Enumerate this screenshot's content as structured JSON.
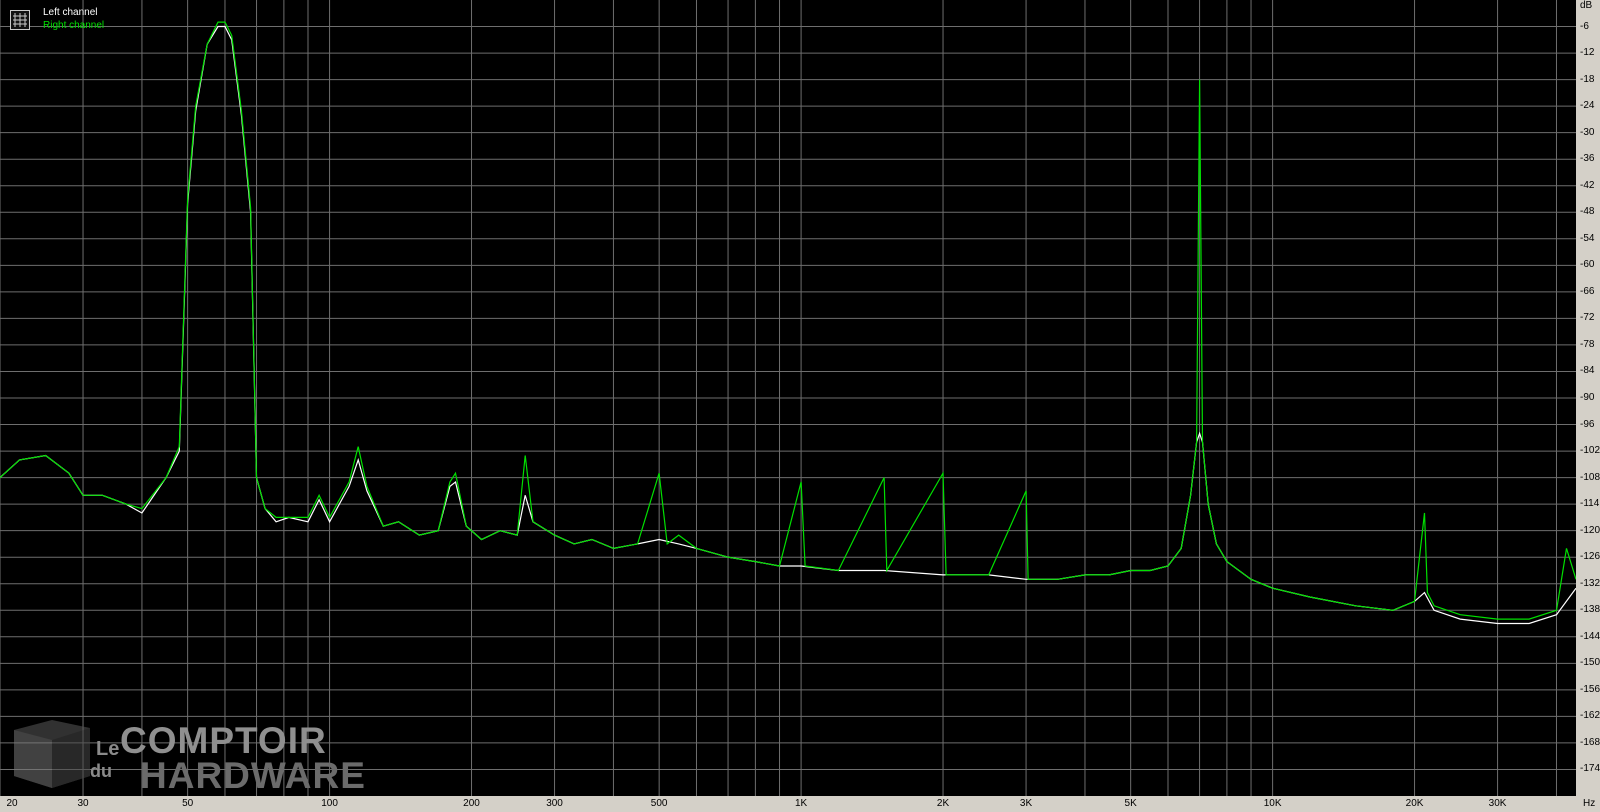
{
  "legend": {
    "left_label": "Left channel",
    "right_label": "Right channel",
    "left_color": "#ffffff",
    "right_color": "#00e000"
  },
  "watermark": {
    "le": "Le",
    "du": "du",
    "comptoir": "COMPTOIR",
    "hardware": "HARDWARE"
  },
  "chart_data": {
    "type": "line",
    "xscale": "log",
    "xlim": [
      20,
      44000
    ],
    "ylim": [
      -180,
      0
    ],
    "xunit": "Hz",
    "yunit": "dB",
    "grid": true,
    "legend_position": "top-left",
    "x_tick_labels": [
      "20",
      "30",
      "50",
      "100",
      "200",
      "300",
      "500",
      "1K",
      "2K",
      "3K",
      "5K",
      "10K",
      "20K",
      "30K"
    ],
    "x_tick_values": [
      20,
      30,
      50,
      100,
      200,
      300,
      500,
      1000,
      2000,
      3000,
      5000,
      10000,
      20000,
      30000
    ],
    "y_tick_values": [
      -6,
      -12,
      -18,
      -24,
      -30,
      -36,
      -42,
      -48,
      -54,
      -60,
      -66,
      -72,
      -78,
      -84,
      -90,
      -96,
      -102,
      -108,
      -114,
      -120,
      -126,
      -132,
      -138,
      -144,
      -150,
      -156,
      -162,
      -168,
      -174
    ],
    "series": [
      {
        "name": "Left channel",
        "color": "#ffffff",
        "points": [
          [
            20,
            -108
          ],
          [
            22,
            -104
          ],
          [
            25,
            -103
          ],
          [
            28,
            -107
          ],
          [
            30,
            -112
          ],
          [
            33,
            -112
          ],
          [
            37,
            -114
          ],
          [
            40,
            -116
          ],
          [
            45,
            -108
          ],
          [
            48,
            -102
          ],
          [
            50,
            -46
          ],
          [
            52,
            -25
          ],
          [
            55,
            -10
          ],
          [
            58,
            -6
          ],
          [
            60,
            -6
          ],
          [
            62,
            -9
          ],
          [
            65,
            -26
          ],
          [
            68,
            -48
          ],
          [
            70,
            -108
          ],
          [
            73,
            -115
          ],
          [
            77,
            -118
          ],
          [
            82,
            -117
          ],
          [
            90,
            -118
          ],
          [
            95,
            -113
          ],
          [
            100,
            -118
          ],
          [
            110,
            -110
          ],
          [
            115,
            -104
          ],
          [
            120,
            -111
          ],
          [
            130,
            -119
          ],
          [
            140,
            -118
          ],
          [
            155,
            -121
          ],
          [
            170,
            -120
          ],
          [
            180,
            -110
          ],
          [
            185,
            -109
          ],
          [
            195,
            -119
          ],
          [
            210,
            -122
          ],
          [
            230,
            -120
          ],
          [
            250,
            -121
          ],
          [
            260,
            -112
          ],
          [
            270,
            -118
          ],
          [
            300,
            -121
          ],
          [
            330,
            -123
          ],
          [
            360,
            -122
          ],
          [
            400,
            -124
          ],
          [
            450,
            -123
          ],
          [
            500,
            -122
          ],
          [
            550,
            -123
          ],
          [
            600,
            -124
          ],
          [
            700,
            -126
          ],
          [
            800,
            -127
          ],
          [
            900,
            -128
          ],
          [
            1000,
            -128
          ],
          [
            1200,
            -129
          ],
          [
            1500,
            -129
          ],
          [
            2000,
            -130
          ],
          [
            2500,
            -130
          ],
          [
            3000,
            -131
          ],
          [
            3500,
            -131
          ],
          [
            4000,
            -130
          ],
          [
            4500,
            -130
          ],
          [
            5000,
            -129
          ],
          [
            5500,
            -129
          ],
          [
            6000,
            -128
          ],
          [
            6400,
            -124
          ],
          [
            6700,
            -112
          ],
          [
            6900,
            -100
          ],
          [
            7000,
            -98
          ],
          [
            7100,
            -100
          ],
          [
            7300,
            -114
          ],
          [
            7600,
            -123
          ],
          [
            8000,
            -127
          ],
          [
            9000,
            -131
          ],
          [
            10000,
            -133
          ],
          [
            12000,
            -135
          ],
          [
            15000,
            -137
          ],
          [
            18000,
            -138
          ],
          [
            20000,
            -136
          ],
          [
            21000,
            -134
          ],
          [
            22000,
            -138
          ],
          [
            25000,
            -140
          ],
          [
            30000,
            -141
          ],
          [
            35000,
            -141
          ],
          [
            40000,
            -139
          ],
          [
            44000,
            -133
          ]
        ]
      },
      {
        "name": "Right channel",
        "color": "#00e000",
        "points": [
          [
            20,
            -108
          ],
          [
            22,
            -104
          ],
          [
            25,
            -103
          ],
          [
            28,
            -107
          ],
          [
            30,
            -112
          ],
          [
            33,
            -112
          ],
          [
            37,
            -114
          ],
          [
            40,
            -115
          ],
          [
            45,
            -108
          ],
          [
            48,
            -101
          ],
          [
            50,
            -45
          ],
          [
            52,
            -24
          ],
          [
            55,
            -10
          ],
          [
            58,
            -5
          ],
          [
            60,
            -5
          ],
          [
            62,
            -8
          ],
          [
            65,
            -25
          ],
          [
            68,
            -47
          ],
          [
            70,
            -108
          ],
          [
            73,
            -115
          ],
          [
            77,
            -117
          ],
          [
            82,
            -117
          ],
          [
            90,
            -117
          ],
          [
            95,
            -112
          ],
          [
            100,
            -117
          ],
          [
            110,
            -109
          ],
          [
            115,
            -101
          ],
          [
            120,
            -110
          ],
          [
            130,
            -119
          ],
          [
            140,
            -118
          ],
          [
            155,
            -121
          ],
          [
            170,
            -120
          ],
          [
            180,
            -109
          ],
          [
            185,
            -107
          ],
          [
            195,
            -119
          ],
          [
            210,
            -122
          ],
          [
            230,
            -120
          ],
          [
            250,
            -121
          ],
          [
            260,
            -103
          ],
          [
            270,
            -118
          ],
          [
            300,
            -121
          ],
          [
            330,
            -123
          ],
          [
            360,
            -122
          ],
          [
            400,
            -124
          ],
          [
            450,
            -123
          ],
          [
            500,
            -107
          ],
          [
            520,
            -123
          ],
          [
            550,
            -121
          ],
          [
            600,
            -124
          ],
          [
            700,
            -126
          ],
          [
            800,
            -127
          ],
          [
            900,
            -128
          ],
          [
            1000,
            -109
          ],
          [
            1020,
            -128
          ],
          [
            1200,
            -129
          ],
          [
            1500,
            -108
          ],
          [
            1520,
            -129
          ],
          [
            2000,
            -107
          ],
          [
            2030,
            -130
          ],
          [
            2500,
            -130
          ],
          [
            3000,
            -111
          ],
          [
            3030,
            -131
          ],
          [
            3500,
            -131
          ],
          [
            4000,
            -130
          ],
          [
            4500,
            -130
          ],
          [
            5000,
            -129
          ],
          [
            5500,
            -129
          ],
          [
            6000,
            -128
          ],
          [
            6400,
            -124
          ],
          [
            6700,
            -112
          ],
          [
            6900,
            -100
          ],
          [
            7000,
            -18
          ],
          [
            7100,
            -100
          ],
          [
            7300,
            -114
          ],
          [
            7600,
            -123
          ],
          [
            8000,
            -127
          ],
          [
            9000,
            -131
          ],
          [
            10000,
            -133
          ],
          [
            12000,
            -135
          ],
          [
            15000,
            -137
          ],
          [
            18000,
            -138
          ],
          [
            20000,
            -136
          ],
          [
            21000,
            -116
          ],
          [
            21300,
            -134
          ],
          [
            22000,
            -137
          ],
          [
            25000,
            -139
          ],
          [
            30000,
            -140
          ],
          [
            35000,
            -140
          ],
          [
            40000,
            -138
          ],
          [
            42000,
            -124
          ],
          [
            44000,
            -131
          ]
        ]
      }
    ]
  }
}
